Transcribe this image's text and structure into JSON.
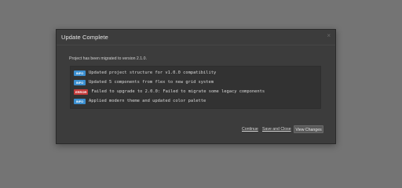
{
  "dialog": {
    "title": "Update Complete",
    "close_glyph": "×",
    "message": "Project has been migrated to version 2.1.0."
  },
  "log": {
    "entries": [
      {
        "level": "INFO",
        "text": "Updated project structure for v1.0.0 compatibility"
      },
      {
        "level": "INFO",
        "text": "Updated 5 components from flex to new grid system"
      },
      {
        "level": "ERROR",
        "text": "Failed to upgrade to 2.0.0: Failed to migrate some legacy components"
      },
      {
        "level": "INFO",
        "text": "Applied modern theme and updated color palette"
      }
    ]
  },
  "footer": {
    "continue_label": "Continue",
    "save_close_label": "Save and Close",
    "view_changes_label": "View Changes"
  },
  "colors": {
    "info": "#3c8fd0",
    "error": "#c43b3b",
    "dialog_bg": "#3c3c3c",
    "backdrop": "#747474"
  }
}
